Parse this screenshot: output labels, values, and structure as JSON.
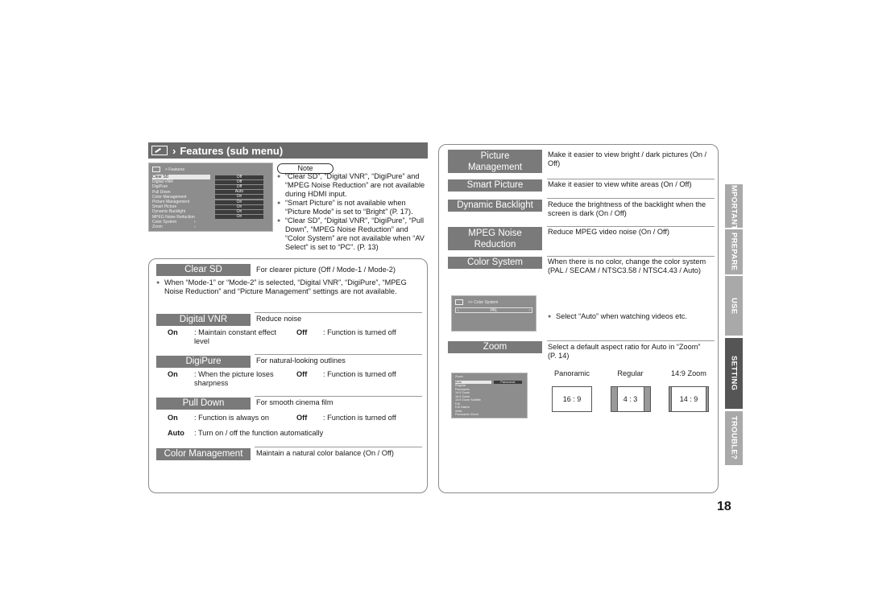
{
  "header": {
    "title": "Features (sub menu)",
    "chevron": "›"
  },
  "osd_features": {
    "title": "> Features",
    "rows": [
      {
        "label": "Clear SD",
        "value": "Off",
        "selected": true
      },
      {
        "label": "Digital VNR",
        "value": "Off"
      },
      {
        "label": "DigiPure",
        "value": "Off"
      },
      {
        "label": "Pull Down",
        "value": "Auto"
      },
      {
        "label": "Color Management",
        "value": "On"
      },
      {
        "label": "Picture Management",
        "value": "On"
      },
      {
        "label": "Smart Picture",
        "value": "On"
      },
      {
        "label": "Dynamic Backlight",
        "value": "On"
      },
      {
        "label": "MPEG Noise Reduction",
        "value": "On"
      },
      {
        "label": "Color System",
        "value": "›"
      },
      {
        "label": "Zoom",
        "value": "›"
      }
    ]
  },
  "note": {
    "label": "Note",
    "items": [
      "“Clear SD”, “Digital VNR”, “DigiPure” and “MPEG Noise Reduction” are not available during HDMI input.",
      "“Smart Picture” is not available when “Picture Mode” is set to “Bright” (P. 17).",
      "“Clear SD”, “Digital VNR”, “DigiPure”, “Pull Down”, “MPEG Noise Reduction” and “Color System” are not available when “AV Select” is set to “PC”. (P. 13)"
    ]
  },
  "left": {
    "clear_sd": {
      "label": "Clear SD",
      "desc": "For clearer picture (Off / Mode-1 / Mode-2)",
      "bullet": "When “Mode-1” or “Mode-2” is selected, “Digital VNR”, “DigiPure”, “MPEG Noise Reduction” and “Picture Management” settings are not available."
    },
    "digital_vnr": {
      "label": "Digital VNR",
      "desc": "Reduce noise",
      "on_key": "On",
      "on_text": ": Maintain constant effect level",
      "off_key": "Off",
      "off_text": ": Function is turned off"
    },
    "digipure": {
      "label": "DigiPure",
      "desc": "For natural-looking outlines",
      "on_key": "On",
      "on_text": ": When the picture loses sharpness",
      "off_key": "Off",
      "off_text": ": Function is turned off"
    },
    "pull_down": {
      "label": "Pull Down",
      "desc": "For smooth cinema film",
      "on_key": "On",
      "on_text": ": Function is always on",
      "off_key": "Off",
      "off_text": ": Function is turned off",
      "auto_key": "Auto",
      "auto_text": ": Turn on / off the function automatically"
    },
    "color_management": {
      "label": "Color Management",
      "desc": "Maintain a natural color balance (On / Off)"
    }
  },
  "right": {
    "picture_management": {
      "label": "Picture Management",
      "desc": "Make it easier to view bright / dark pictures (On / Off)"
    },
    "smart_picture": {
      "label": "Smart Picture",
      "desc": "Make it easier to view white areas (On / Off)"
    },
    "dynamic_backlight": {
      "label": "Dynamic Backlight",
      "desc": "Reduce the brightness of the backlight when the screen is dark (On / Off)"
    },
    "mpeg_nr": {
      "label": "MPEG Noise Reduction",
      "desc": "Reduce MPEG video noise (On / Off)"
    },
    "color_system": {
      "label": "Color System",
      "desc": "When there is no color, change the color system (PAL / SECAM / NTSC3.58 / NTSC4.43 / Auto)",
      "bullet": "Select “Auto” when watching videos etc.",
      "osd_title": ">> Color System",
      "osd_value": "PAL"
    },
    "zoom": {
      "label": "Zoom",
      "desc": "Select a default aspect ratio for Auto in “Zoom” (P. 14)",
      "osd_title": "Zoom",
      "osd_rows": [
        "Auto",
        "Regular",
        "Panoramic",
        "14:9 Zoom",
        "16:9 Zoom",
        "14:9 Zoom Subtitle",
        "Full",
        "Full Native",
        "Wide",
        "Panoramic Zoom"
      ],
      "osd_value": "Panoramic",
      "ratios": [
        {
          "name": "Panoramic",
          "ratio": "16 : 9"
        },
        {
          "name": "Regular",
          "ratio": "4 : 3"
        },
        {
          "name": "14:9 Zoom",
          "ratio": "14 : 9"
        }
      ]
    }
  },
  "tabs": [
    {
      "label": "IMPORTANT",
      "active": false
    },
    {
      "label": "PREPARE",
      "active": false
    },
    {
      "label": "USE",
      "active": false
    },
    {
      "label": "SETTING",
      "active": true
    },
    {
      "label": "TROUBLE?",
      "active": false
    }
  ],
  "page_number": "18"
}
